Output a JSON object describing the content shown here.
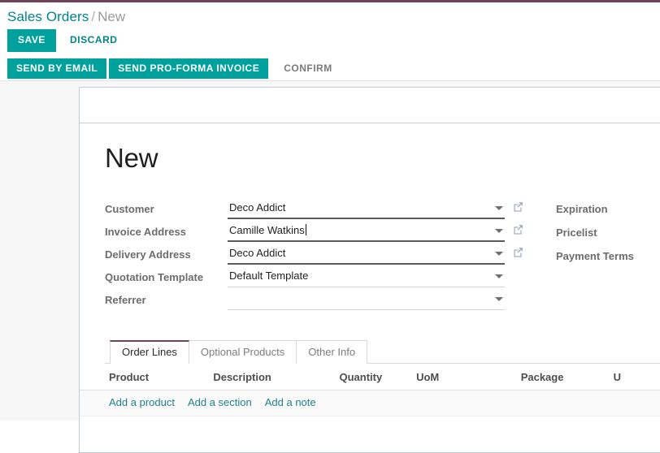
{
  "theme": {
    "accent_teal": "#00a09d",
    "link_teal": "#00848e",
    "accent_purple": "#71435b",
    "label_gray": "#6c6c6c"
  },
  "breadcrumb": {
    "root": "Sales Orders",
    "separator": "/",
    "current": "New"
  },
  "action_bar": {
    "save_label": "SAVE",
    "discard_label": "DISCARD"
  },
  "statusbar": {
    "buttons": [
      {
        "label": "SEND BY EMAIL",
        "style": "primary"
      },
      {
        "label": "SEND PRO-FORMA INVOICE",
        "style": "primary"
      },
      {
        "label": "CONFIRM",
        "style": "plain"
      }
    ],
    "send_by_email": "SEND BY EMAIL",
    "send_proforma": "SEND PRO-FORMA INVOICE",
    "confirm": "CONFIRM"
  },
  "record": {
    "title": "New"
  },
  "form": {
    "left": [
      {
        "label": "Customer",
        "value": "Deco Addict",
        "has_external_link": true,
        "focused": false,
        "underline": "dark"
      },
      {
        "label": "Invoice Address",
        "value": "Camille Watkins",
        "has_external_link": true,
        "focused": true,
        "underline": "dark"
      },
      {
        "label": "Delivery Address",
        "value": "Deco Addict",
        "has_external_link": true,
        "focused": false,
        "underline": "dark"
      },
      {
        "label": "Quotation Template",
        "value": "Default Template",
        "has_external_link": false,
        "focused": false,
        "underline": "light"
      },
      {
        "label": "Referrer",
        "value": "",
        "has_external_link": false,
        "focused": false,
        "underline": "light"
      }
    ],
    "right": [
      {
        "label": "Expiration"
      },
      {
        "label": "Pricelist"
      },
      {
        "label": "Payment Terms"
      }
    ]
  },
  "notebook": {
    "tabs": [
      {
        "label": "Order Lines",
        "active": true
      },
      {
        "label": "Optional Products",
        "active": false
      },
      {
        "label": "Other Info",
        "active": false
      }
    ],
    "order_lines": {
      "columns": [
        "Product",
        "Description",
        "Quantity",
        "UoM",
        "Package",
        "U"
      ],
      "rows": [],
      "add_links": [
        "Add a product",
        "Add a section",
        "Add a note"
      ]
    }
  }
}
